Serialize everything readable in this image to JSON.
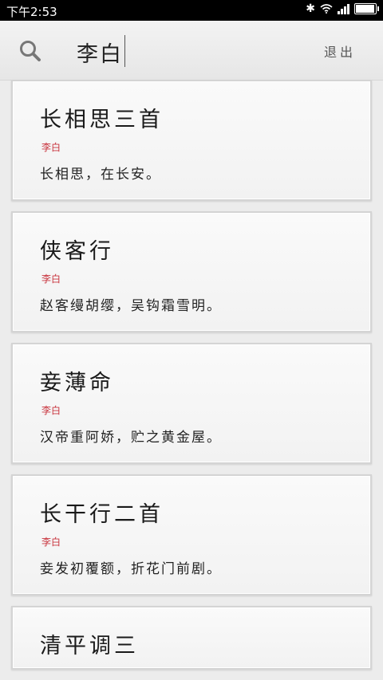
{
  "status_bar": {
    "time": "下午2:53",
    "icons": [
      "bluetooth-icon",
      "wifi-icon",
      "signal-icon",
      "battery-icon"
    ]
  },
  "header": {
    "search_icon": "search-icon",
    "query": "李白",
    "logout_label": "退出"
  },
  "colors": {
    "author_red": "#c8323c",
    "card_bg": "#f7f7f7",
    "page_bg": "#ececec"
  },
  "results": [
    {
      "title": "长相思三首",
      "author": "李白",
      "line": "长相思，在长安。"
    },
    {
      "title": "侠客行",
      "author": "李白",
      "line": "赵客缦胡缨，吴钩霜雪明。"
    },
    {
      "title": "妾薄命",
      "author": "李白",
      "line": "汉帝重阿娇，贮之黄金屋。"
    },
    {
      "title": "长干行二首",
      "author": "李白",
      "line": "妾发初覆额，折花门前剧。"
    },
    {
      "title": "清平调三",
      "author": "",
      "line": ""
    }
  ]
}
